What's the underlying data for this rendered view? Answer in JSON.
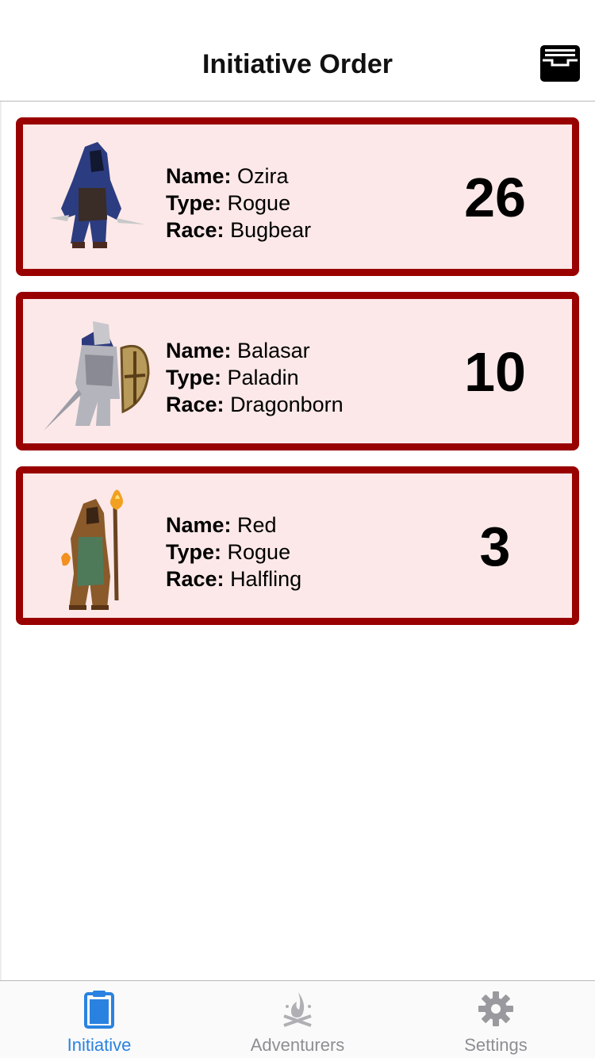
{
  "header": {
    "title": "Initiative Order",
    "action_icon": "inbox-tray-icon"
  },
  "combatants": [
    {
      "name_label": "Name:",
      "name": "Ozira",
      "type_label": "Type:",
      "type": "Rogue",
      "race_label": "Race:",
      "race": "Bugbear",
      "initiative": "26",
      "portrait": "hooded-rogue-sprite"
    },
    {
      "name_label": "Name:",
      "name": "Balasar",
      "type_label": "Type:",
      "type": "Paladin",
      "race_label": "Race:",
      "race": "Dragonborn",
      "initiative": "10",
      "portrait": "armored-paladin-sprite"
    },
    {
      "name_label": "Name:",
      "name": "Red",
      "type_label": "Type:",
      "type": "Rogue",
      "race_label": "Race:",
      "race": "Halfling",
      "initiative": "3",
      "portrait": "robed-caster-sprite"
    }
  ],
  "tabs": [
    {
      "label": "Initiative",
      "icon": "clipboard-icon",
      "active": true
    },
    {
      "label": "Adventurers",
      "icon": "campfire-icon",
      "active": false
    },
    {
      "label": "Settings",
      "icon": "gear-icon",
      "active": false
    }
  ],
  "colors": {
    "card_border": "#990000",
    "card_background": "#fce8e8",
    "active_tab": "#2a82e0",
    "inactive_tab": "#8e8e93"
  }
}
